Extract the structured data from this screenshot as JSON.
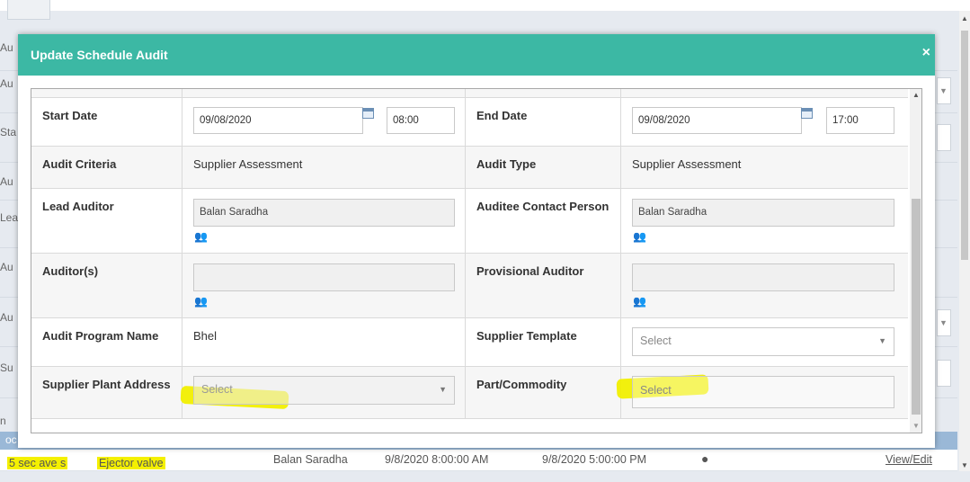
{
  "background": {
    "left_labels": [
      "Au",
      "Au",
      "Sta",
      "Au",
      "Lea",
      "Au",
      "Au",
      "Su",
      "n",
      "oc"
    ],
    "data_row": {
      "col1": "5 sec ave s",
      "col2": "Ejector valve",
      "col3": "Balan Saradha",
      "col4": "9/8/2020 8:00:00 AM",
      "col5": "9/8/2020 5:00:00 PM",
      "status_dot": "●",
      "action": "View/Edit"
    }
  },
  "modal": {
    "title": "Update Schedule Audit",
    "close_glyph": "×",
    "rows": {
      "start_date": {
        "label": "Start Date",
        "date_value": "09/08/2020",
        "time_value": "08:00"
      },
      "end_date": {
        "label": "End Date",
        "date_value": "09/08/2020",
        "time_value": "17:00"
      },
      "audit_criteria": {
        "label": "Audit Criteria",
        "value": "Supplier Assessment"
      },
      "audit_type": {
        "label": "Audit Type",
        "value": "Supplier Assessment"
      },
      "lead_auditor": {
        "label": "Lead Auditor",
        "value": "Balan Saradha"
      },
      "auditee_contact": {
        "label": "Auditee Contact Person",
        "value": "Balan Saradha"
      },
      "auditors": {
        "label": "Auditor(s)",
        "value": ""
      },
      "provisional_auditor": {
        "label": "Provisional Auditor",
        "value": ""
      },
      "audit_program_name": {
        "label": "Audit Program Name",
        "value": "Bhel"
      },
      "supplier_template": {
        "label": "Supplier Template",
        "selected": "Select"
      },
      "supplier_plant_address": {
        "label": "Supplier Plant Address",
        "selected": "Select"
      },
      "part_commodity": {
        "label": "Part/Commodity",
        "selected": "Select"
      }
    }
  },
  "colors": {
    "header": "#3cb8a4",
    "highlight": "#f4f000"
  }
}
